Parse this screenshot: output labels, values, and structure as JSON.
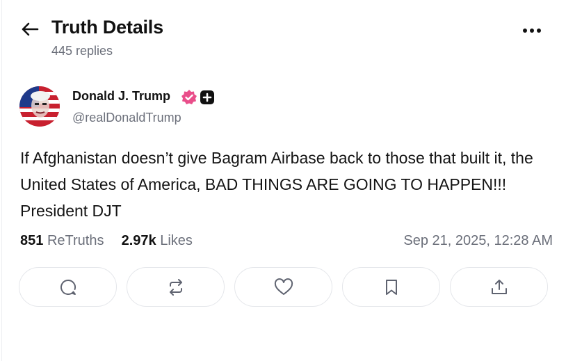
{
  "header": {
    "title": "Truth Details",
    "subtitle": "445 replies"
  },
  "post": {
    "author_name": "Donald J. Trump",
    "handle": "@realDonaldTrump",
    "text": "If Afghanistan doesn’t give Bagram Airbase back to those that built it, the United States of America, BAD THINGS ARE GOING TO HAPPEN!!! President DJT",
    "retruths_count": "851",
    "retruths_label": "ReTruths",
    "likes_count": "2.97k",
    "likes_label": "Likes",
    "timestamp": "Sep 21, 2025, 12:28 AM"
  },
  "icons": {
    "back": "arrow-left-icon",
    "more": "more-horizontal-icon",
    "verified": "verified-badge-icon",
    "plus": "plus-badge-icon",
    "reply": "comment-icon",
    "retruth": "repost-icon",
    "like": "heart-icon",
    "bookmark": "bookmark-icon",
    "share": "share-icon"
  },
  "colors": {
    "verified": "#e94e8a",
    "text": "#111111",
    "muted": "#6b6f7a",
    "border": "#e4e6ea"
  }
}
